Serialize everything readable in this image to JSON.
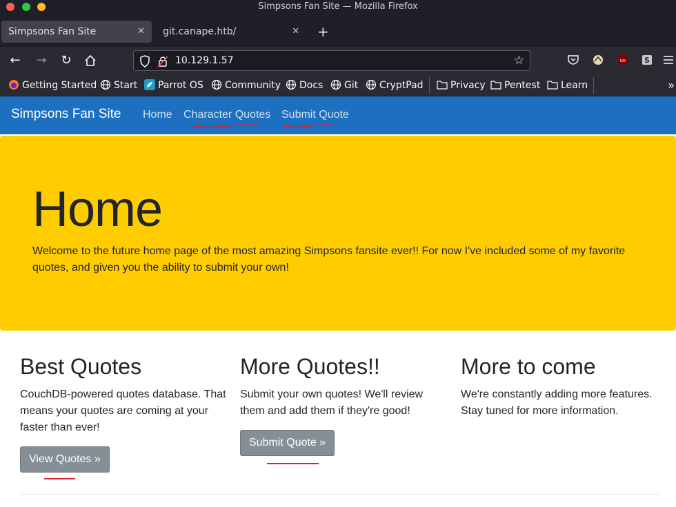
{
  "window": {
    "title": "Simpsons Fan Site — Mozilla Firefox"
  },
  "tabs": [
    {
      "label": "Simpsons Fan Site",
      "active": true
    },
    {
      "label": "git.canape.htb/",
      "active": false
    }
  ],
  "urlbar": {
    "url": "10.129.1.57"
  },
  "bookmarks": [
    {
      "label": "Getting Started",
      "icon": "firefox-icon"
    },
    {
      "label": "Start",
      "icon": "globe-icon"
    },
    {
      "label": "Parrot OS",
      "icon": "parrot-icon"
    },
    {
      "label": "Community",
      "icon": "globe-icon"
    },
    {
      "label": "Docs",
      "icon": "globe-icon"
    },
    {
      "label": "Git",
      "icon": "globe-icon"
    },
    {
      "label": "CryptPad",
      "icon": "globe-icon"
    },
    {
      "label": "Privacy",
      "icon": "folder-icon"
    },
    {
      "label": "Pentest",
      "icon": "folder-icon"
    },
    {
      "label": "Learn",
      "icon": "folder-icon"
    }
  ],
  "site": {
    "brand": "Simpsons Fan Site",
    "nav": [
      "Home",
      "Character Quotes",
      "Submit Quote"
    ],
    "jumbotron": {
      "title": "Home",
      "text": "Welcome to the future home page of the most amazing Simpsons fansite ever!! For now I've included some of my favorite quotes, and given you the ability to submit your own!"
    },
    "columns": [
      {
        "heading": "Best Quotes",
        "text": "CouchDB-powered quotes database. That means your quotes are coming at your faster than ever!",
        "button": "View Quotes »"
      },
      {
        "heading": "More Quotes!!",
        "text": "Submit your own quotes! We'll review them and add them if they're good!",
        "button": "Submit Quote »"
      },
      {
        "heading": "More to come",
        "text": "We're constantly adding more features. Stay tuned for more information."
      }
    ]
  },
  "colors": {
    "nav_bg": "#1d6fbf",
    "jumbo_bg": "#ffcc00",
    "button_bg": "#868e96",
    "annotation_red": "#e0202a"
  }
}
